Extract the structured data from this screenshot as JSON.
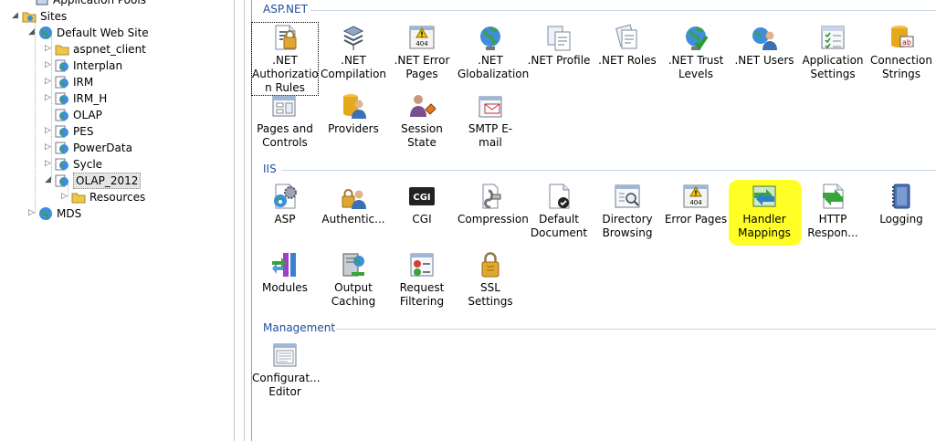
{
  "tree": {
    "nodes": [
      {
        "label": "Application Pools",
        "icon": "app-pools-icon"
      },
      {
        "label": "Sites",
        "icon": "sites-folder-icon"
      },
      {
        "label": "Default Web Site",
        "icon": "globe-icon"
      },
      {
        "label": "aspnet_client",
        "icon": "folder-icon"
      },
      {
        "label": "Interplan",
        "icon": "web-app-icon"
      },
      {
        "label": "IRM",
        "icon": "web-app-icon"
      },
      {
        "label": "IRM_H",
        "icon": "web-app-icon"
      },
      {
        "label": "OLAP",
        "icon": "web-app-icon"
      },
      {
        "label": "PES",
        "icon": "web-app-icon"
      },
      {
        "label": "PowerData",
        "icon": "web-app-icon"
      },
      {
        "label": "Sycle",
        "icon": "web-app-icon"
      },
      {
        "label": "OLAP_2012",
        "icon": "web-app-icon"
      },
      {
        "label": "Resources",
        "icon": "folder-icon"
      },
      {
        "label": "MDS",
        "icon": "globe-icon"
      }
    ]
  },
  "groups": {
    "aspnet": {
      "title": "ASP.NET",
      "features": [
        {
          "l1": ".NET",
          "l2": "Authorizatio",
          "l3": "n Rules",
          "icon": "authorization-rules-icon"
        },
        {
          "l1": ".NET",
          "l2": "Compilation",
          "icon": "compilation-icon"
        },
        {
          "l1": ".NET Error",
          "l2": "Pages",
          "icon": "error-pages-icon"
        },
        {
          "l1": ".NET",
          "l2": "Globalization",
          "icon": "globe-icon"
        },
        {
          "l1": ".NET Profile",
          "icon": "profile-icon"
        },
        {
          "l1": ".NET Roles",
          "icon": "roles-icon"
        },
        {
          "l1": ".NET Trust",
          "l2": "Levels",
          "icon": "trust-levels-icon"
        },
        {
          "l1": ".NET Users",
          "icon": "users-icon"
        },
        {
          "l1": "Application",
          "l2": "Settings",
          "icon": "app-settings-icon"
        },
        {
          "l1": "Connection",
          "l2": "Strings",
          "icon": "connection-strings-icon"
        },
        {
          "l1": "Pages and",
          "l2": "Controls",
          "icon": "pages-controls-icon"
        },
        {
          "l1": "Providers",
          "icon": "providers-icon"
        },
        {
          "l1": "Session State",
          "icon": "session-state-icon"
        },
        {
          "l1": "SMTP E-mail",
          "icon": "smtp-email-icon"
        }
      ]
    },
    "iis": {
      "title": "IIS",
      "features": [
        {
          "l1": "ASP",
          "icon": "asp-icon"
        },
        {
          "l1": "Authentic...",
          "icon": "authentication-icon"
        },
        {
          "l1": "CGI",
          "icon": "cgi-icon",
          "text": "CGI"
        },
        {
          "l1": "Compression",
          "icon": "compression-icon"
        },
        {
          "l1": "Default",
          "l2": "Document",
          "icon": "default-document-icon"
        },
        {
          "l1": "Directory",
          "l2": "Browsing",
          "icon": "directory-browsing-icon"
        },
        {
          "l1": "Error Pages",
          "icon": "error-pages-icon"
        },
        {
          "l1": "Handler",
          "l2": "Mappings",
          "icon": "handler-mappings-icon"
        },
        {
          "l1": "HTTP",
          "l2": "Respon...",
          "icon": "http-response-icon"
        },
        {
          "l1": "Logging",
          "icon": "logging-icon"
        },
        {
          "l1": "Modules",
          "icon": "modules-icon"
        },
        {
          "l1": "Output",
          "l2": "Caching",
          "icon": "output-caching-icon"
        },
        {
          "l1": "Request",
          "l2": "Filtering",
          "icon": "request-filtering-icon"
        },
        {
          "l1": "SSL Settings",
          "icon": "ssl-settings-icon"
        }
      ]
    },
    "management": {
      "title": "Management",
      "features": [
        {
          "l1": "Configurat...",
          "l2": "Editor",
          "icon": "configuration-editor-icon"
        }
      ]
    }
  },
  "icon_badge_404": "404",
  "colors": {
    "group_title": "#1e4e9c",
    "highlight": "#ffff00",
    "selected_node": "#e5e5e5"
  }
}
